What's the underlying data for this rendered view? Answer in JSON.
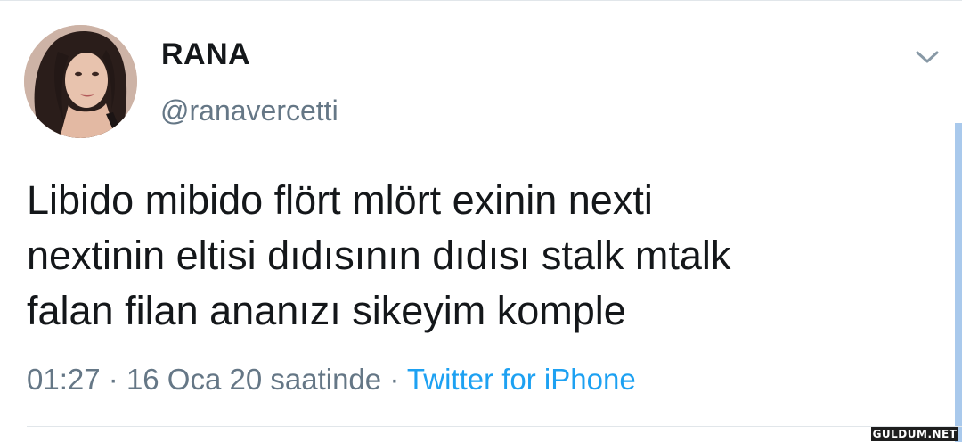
{
  "tweet": {
    "display_name": "RANA",
    "handle": "@ranavercetti",
    "text": "Libido mibido flört mlört exinin nexti\nnextinin eltisi dıdısının dıdısı stalk mtalk\nfalan filan ananızı sikeyim komple",
    "time": "01:27",
    "date": "16 Oca 20 saatinde",
    "separator": "·",
    "source": "Twitter for iPhone"
  },
  "icons": {
    "menu": "chevron-down-icon",
    "avatar": "profile-photo"
  },
  "watermark": "GULDUM.NET",
  "colors": {
    "text": "#14171a",
    "secondary": "#657786",
    "link": "#1da1f2",
    "divider": "#e1e6ea"
  }
}
